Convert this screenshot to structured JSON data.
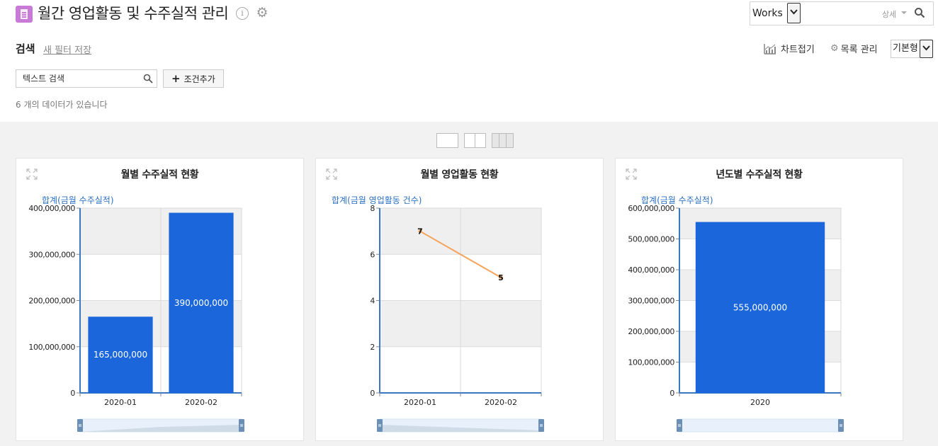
{
  "header": {
    "title": "월간 영업활동 및 수주실적 관리",
    "search_scope": "Works",
    "detail_label": "상세"
  },
  "filter_bar": {
    "search_label": "검색",
    "new_filter_label": "새 필터 저장",
    "chart_fold_label": "차트접기",
    "list_manage_label": "목록 관리",
    "view_mode": "기본형",
    "text_search_placeholder": "텍스트 검색",
    "add_condition_label": "조건추가",
    "add_icon": "+",
    "result_count": "6 개의 데이터가 있습니다"
  },
  "colors": {
    "bar": "#1a66da",
    "line": "#f5a45c",
    "axis_title": "#2a6fc4",
    "app_icon": "#c77ad6"
  },
  "chart_data": [
    {
      "type": "bar",
      "title": "월별 수주실적 현황",
      "ylabel": "합계(금월 수주실적)",
      "categories": [
        "2020-01",
        "2020-02"
      ],
      "values": [
        165000000,
        390000000
      ],
      "value_labels": [
        "165,000,000",
        "390,000,000"
      ],
      "yticks": [
        0,
        100000000,
        200000000,
        300000000,
        400000000
      ],
      "ytick_labels": [
        "0",
        "100,000,000",
        "200,000,000",
        "300,000,000",
        "400,000,000"
      ],
      "ylim": [
        0,
        400000000
      ],
      "grid": true
    },
    {
      "type": "line",
      "title": "월별 영업활동 현황",
      "ylabel": "합계(금월 영업활동 건수)",
      "categories": [
        "2020-01",
        "2020-02"
      ],
      "values": [
        7,
        5
      ],
      "value_labels": [
        "7",
        "5"
      ],
      "yticks": [
        0,
        2,
        4,
        6,
        8
      ],
      "ytick_labels": [
        "0",
        "2",
        "4",
        "6",
        "8"
      ],
      "ylim": [
        0,
        8
      ],
      "grid": true
    },
    {
      "type": "bar",
      "title": "년도별 수주실적 현황",
      "ylabel": "합계(금월 수주실적)",
      "categories": [
        "2020"
      ],
      "values": [
        555000000
      ],
      "value_labels": [
        "555,000,000"
      ],
      "yticks": [
        0,
        100000000,
        200000000,
        300000000,
        400000000,
        500000000,
        600000000
      ],
      "ytick_labels": [
        "0",
        "100,000,000",
        "200,000,000",
        "300,000,000",
        "400,000,000",
        "500,000,000",
        "600,000,000"
      ],
      "ylim": [
        0,
        600000000
      ],
      "grid": true
    }
  ]
}
